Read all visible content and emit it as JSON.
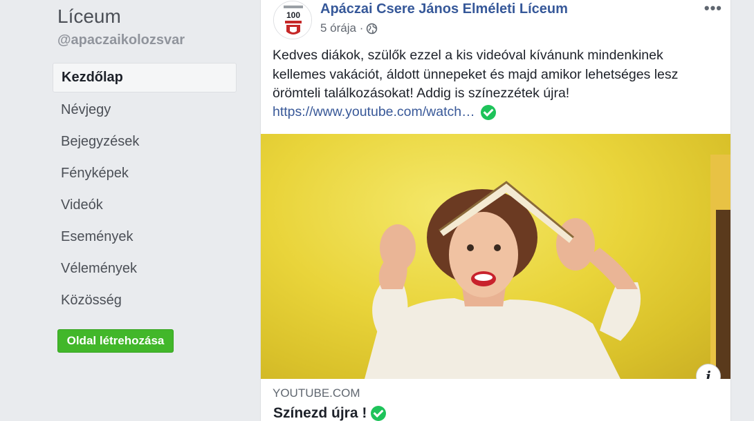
{
  "sidebar": {
    "page_name": "Líceum",
    "page_handle": "@apaczaikolozsvar",
    "nav_items": [
      {
        "label": "Kezdőlap",
        "active": true
      },
      {
        "label": "Névjegy"
      },
      {
        "label": "Bejegyzések"
      },
      {
        "label": "Fényképek"
      },
      {
        "label": "Videók"
      },
      {
        "label": "Események"
      },
      {
        "label": "Vélemények"
      },
      {
        "label": "Közösség"
      }
    ],
    "create_button": "Oldal létrehozása"
  },
  "post": {
    "author": "Apáczai Csere János Elméleti Líceum",
    "avatar_text": "100",
    "time": "5 órája ·",
    "more_label": "•••",
    "text": "Kedves diákok, szülők ezzel a kis videóval kívánunk mindenkinek kellemes vakációt, áldott ünnepeket és majd amikor lehetséges lesz örömteli találkozásokat! Addig is színezzétek újra!",
    "link": "https://www.youtube.com/watch…",
    "link_preview": {
      "domain": "YOUTUBE.COM",
      "title": "Színezd újra !"
    },
    "info_label": "i"
  },
  "colors": {
    "link_blue": "#365899",
    "verified_green": "#1ec35a",
    "create_green": "#42b72a",
    "background": "#e9ebee"
  },
  "icons": {
    "privacy": "globe-icon",
    "verified": "check-circle-icon",
    "more": "ellipsis-icon",
    "info": "info-icon"
  }
}
